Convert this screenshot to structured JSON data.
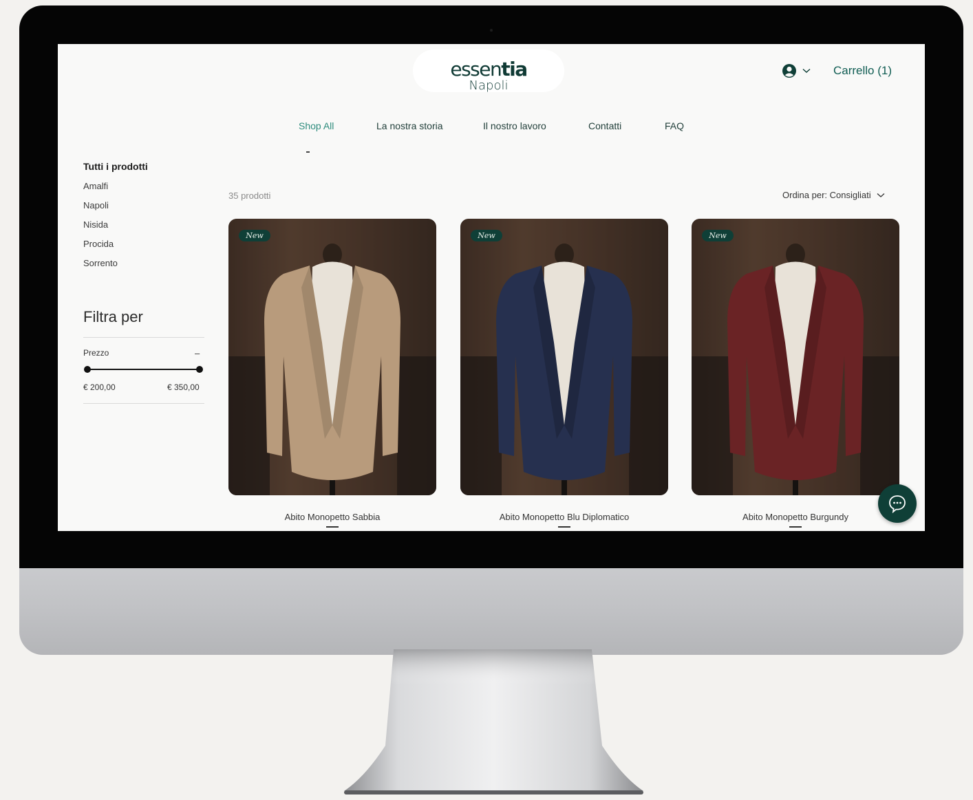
{
  "header": {
    "logo_main_light": "essen",
    "logo_main_bold": "tia",
    "logo_sub": "Napoli",
    "account_icon": "user-circle-icon",
    "cart_label": "Carrello (1)"
  },
  "nav": {
    "items": [
      "Shop All",
      "La nostra storia",
      "Il nostro lavoro",
      "Contatti",
      "FAQ"
    ],
    "active": "Shop All"
  },
  "sidebar": {
    "categories_title": "Tutti i prodotti",
    "categories": [
      "Amalfi",
      "Napoli",
      "Nisida",
      "Procida",
      "Sorrento"
    ],
    "filter_title": "Filtra per",
    "price_label": "Prezzo",
    "price_toggle": "–",
    "price_min": "€ 200,00",
    "price_max": "€ 350,00"
  },
  "listing": {
    "count": "35 prodotti",
    "sort_label": "Ordina per: Consigliati",
    "products": [
      {
        "name": "Abito Monopetto Sabbia",
        "badge": "New",
        "color": "#b89b7c"
      },
      {
        "name": "Abito Monopetto Blu Diplomatico",
        "badge": "New",
        "color": "#26304f"
      },
      {
        "name": "Abito Monopetto Burgundy",
        "badge": "New",
        "color": "#6a2325"
      }
    ]
  },
  "chat": {
    "icon": "chat-bubble-icon"
  },
  "colors": {
    "brand": "#0f3f37",
    "accent": "#2e8c7d",
    "screen_bg": "#f9f9f8"
  }
}
